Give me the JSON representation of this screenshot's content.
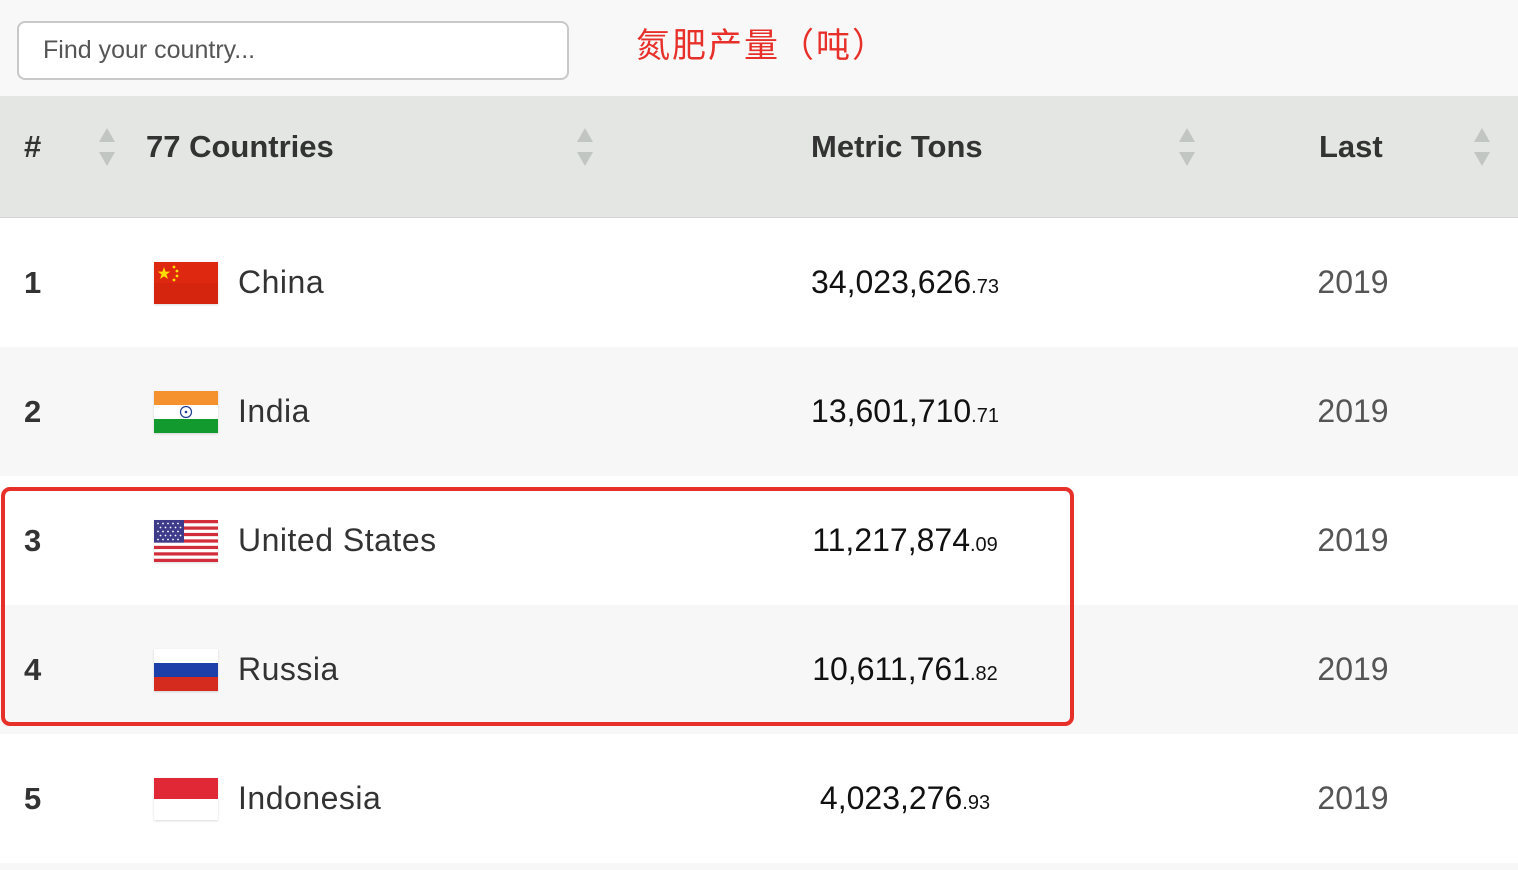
{
  "search": {
    "placeholder": "Find your country..."
  },
  "annotation": {
    "text": "氮肥产量（吨）",
    "color": "#e8302a"
  },
  "table": {
    "headers": {
      "rank": "#",
      "country": "77 Countries",
      "value": "Metric Tons",
      "last": "Last"
    },
    "rows": [
      {
        "rank": "1",
        "country": "China",
        "flag_icon": "china-flag-icon",
        "value_int": "34,023,626",
        "value_dec": ".73",
        "year": "2019"
      },
      {
        "rank": "2",
        "country": "India",
        "flag_icon": "india-flag-icon",
        "value_int": "13,601,710",
        "value_dec": ".71",
        "year": "2019"
      },
      {
        "rank": "3",
        "country": "United States",
        "flag_icon": "usa-flag-icon",
        "value_int": "11,217,874",
        "value_dec": ".09",
        "year": "2019"
      },
      {
        "rank": "4",
        "country": "Russia",
        "flag_icon": "russia-flag-icon",
        "value_int": "10,611,761",
        "value_dec": ".82",
        "year": "2019"
      },
      {
        "rank": "5",
        "country": "Indonesia",
        "flag_icon": "indonesia-flag-icon",
        "value_int": "4,023,276",
        "value_dec": ".93",
        "year": "2019"
      }
    ]
  },
  "colors": {
    "header_bg": "#e3e6e3",
    "highlight_border": "#e8302a",
    "row_alt_bg": "#f7f7f7"
  },
  "icons": {
    "sort": "sort-arrows-icon"
  }
}
